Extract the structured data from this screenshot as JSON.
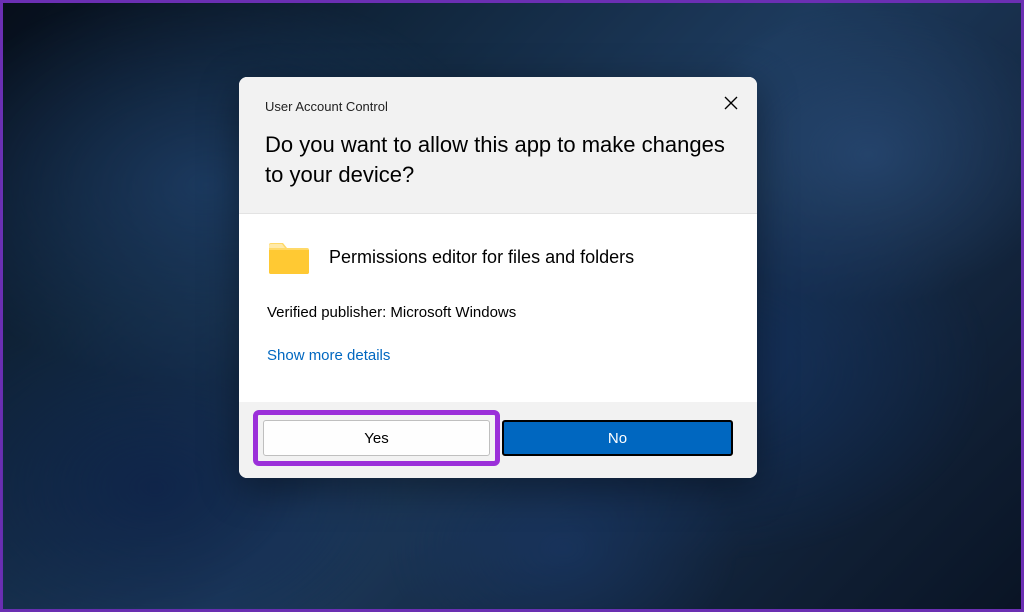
{
  "dialog": {
    "title": "User Account Control",
    "question": "Do you want to allow this app to make changes to your device?",
    "app_name": "Permissions editor for files and folders",
    "publisher_line": "Verified publisher: Microsoft Windows",
    "show_more": "Show more details",
    "yes_label": "Yes",
    "no_label": "No"
  }
}
